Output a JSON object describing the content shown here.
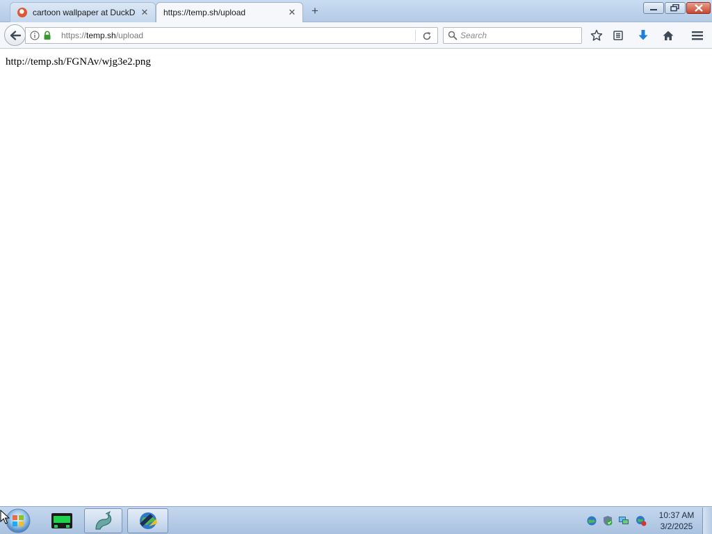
{
  "browser": {
    "tabs": [
      {
        "title": "cartoon wallpaper at DuckD",
        "favicon": "duckduckgo-icon",
        "active": false
      },
      {
        "title": "https://temp.sh/upload",
        "active": true
      }
    ],
    "url": {
      "scheme": "https://",
      "host": "temp.sh",
      "path": "/upload"
    },
    "search": {
      "placeholder": "Search"
    },
    "toolbar_icons": [
      "back-arrow-icon",
      "info-icon",
      "lock-icon",
      "reload-icon",
      "search-icon",
      "star-icon",
      "reading-list-icon",
      "download-icon",
      "home-icon",
      "menu-icon"
    ]
  },
  "page": {
    "body_text": "http://temp.sh/FGNAv/wjg3e2.png"
  },
  "taskbar": {
    "clock_time": "10:37 AM",
    "clock_date": "3/2/2025",
    "apps": [
      "windows-start-orb",
      "terminal-app-icon",
      "dragon-app-icon",
      "download-manager-globe-icon"
    ],
    "tray": [
      "network-globe-icon",
      "security-shield-icon",
      "network-monitor-icon",
      "update-globe-icon"
    ]
  },
  "colors": {
    "titlebar": "#c9dcf2",
    "toolbar": "#f5f7fa",
    "taskbar": "#b7cde8",
    "download_arrow": "#1f7fd8",
    "lock_green": "#3b9a2f",
    "close_red": "#c64732"
  }
}
